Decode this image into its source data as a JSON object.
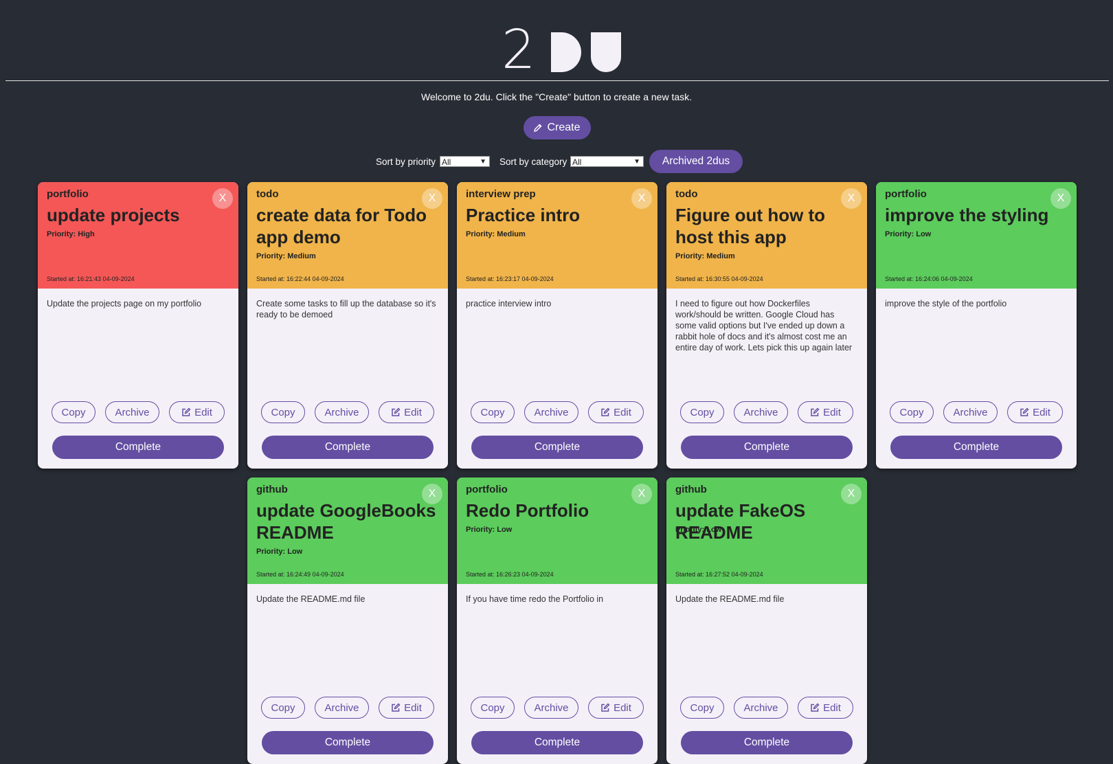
{
  "app": {
    "logo_text": "2DU",
    "welcome": "Welcome to 2du. Click the \"Create\" button to create a new task.",
    "create_label": "Create",
    "sort_priority_label": "Sort by priority",
    "sort_priority_value": "All",
    "sort_category_label": "Sort by category",
    "sort_category_value": "All",
    "archived_label": "Archived 2dus"
  },
  "labels": {
    "copy": "Copy",
    "archive": "Archive",
    "edit": "Edit",
    "complete": "Complete",
    "close": "X"
  },
  "colors": {
    "background": "#282c34",
    "accent": "#634ea2",
    "high": "#f55757",
    "medium": "#f0b44a",
    "low": "#5ccc5c",
    "card_body": "#f4f0f8"
  },
  "tasks": [
    {
      "category": "portfolio",
      "title": "update projects",
      "priority_text": "Priority: High",
      "priority": "High",
      "started": "Started at: 16:21:43 04-09-2024",
      "description": "Update the projects page on my portfolio"
    },
    {
      "category": "todo",
      "title": "create data for Todo app demo",
      "priority_text": "Priority: Medium",
      "priority": "Medium",
      "started": "Started at: 16:22:44 04-09-2024",
      "description": "Create some tasks to fill up the database so it's ready to be demoed"
    },
    {
      "category": "interview prep",
      "title": "Practice intro",
      "priority_text": "Priority: Medium",
      "priority": "Medium",
      "started": "Started at: 16:23:17 04-09-2024",
      "description": "practice interview intro"
    },
    {
      "category": "todo",
      "title": "Figure out how to host this app",
      "priority_text": "Priority: Medium",
      "priority": "Medium",
      "started": "Started at: 16:30:55 04-09-2024",
      "description": "I need to figure out how Dockerfiles work/should be written. Google Cloud has some valid options but I've ended up down a rabbit hole of docs and it's almost cost me an entire day of work. Lets pick this up again later"
    },
    {
      "category": "portfolio",
      "title": "improve the styling",
      "priority_text": "Priority: Low",
      "priority": "Low",
      "started": "Started at: 16:24:06 04-09-2024",
      "description": "improve the style of the portfolio"
    },
    {
      "category": "github",
      "title": "update GoogleBooks README",
      "priority_text": "Priority: Low",
      "priority": "Low",
      "started": "Started at: 16:24:49 04-09-2024",
      "description": "Update the README.md file"
    },
    {
      "category": "portfolio",
      "title": "Redo Portfolio",
      "priority_text": "Priority: Low",
      "priority": "Low",
      "started": "Started at: 16:26:23 04-09-2024",
      "description": "If you have time redo the Portfolio in"
    },
    {
      "category": "github",
      "title": "update FakeOS README",
      "priority_text": "Priority: Low",
      "priority": "Low",
      "started": "Started at: 16:27:52 04-09-2024",
      "description": "Update the README.md file"
    }
  ]
}
